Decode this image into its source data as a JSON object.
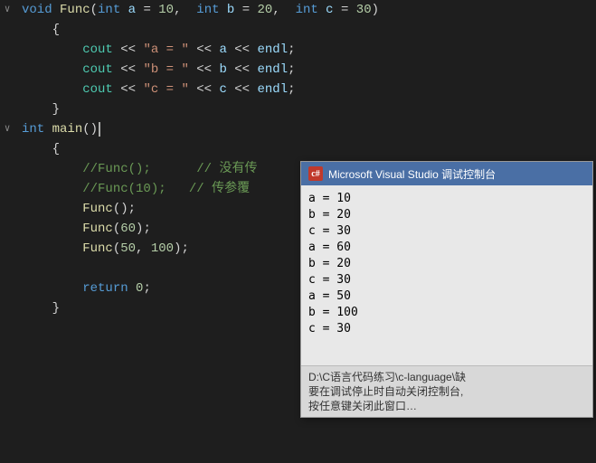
{
  "editor": {
    "background": "#1e1e1e"
  },
  "lines": [
    {
      "num": "",
      "fold": "∨",
      "tokens": [
        {
          "t": "kw",
          "v": "void "
        },
        {
          "t": "fn",
          "v": "Func"
        },
        {
          "t": "plain",
          "v": "("
        },
        {
          "t": "kw",
          "v": "int "
        },
        {
          "t": "param-name",
          "v": "a"
        },
        {
          "t": "plain",
          "v": " = "
        },
        {
          "t": "num",
          "v": "10"
        },
        {
          "t": "plain",
          "v": ",  "
        },
        {
          "t": "kw",
          "v": "int "
        },
        {
          "t": "param-name",
          "v": "b"
        },
        {
          "t": "plain",
          "v": " = "
        },
        {
          "t": "num",
          "v": "20"
        },
        {
          "t": "plain",
          "v": ",  "
        },
        {
          "t": "kw",
          "v": "int "
        },
        {
          "t": "param-name",
          "v": "c"
        },
        {
          "t": "plain",
          "v": " = "
        },
        {
          "t": "num",
          "v": "30"
        },
        {
          "t": "plain",
          "v": ")"
        }
      ]
    },
    {
      "num": "",
      "fold": " ",
      "tokens": [
        {
          "t": "plain",
          "v": "    {"
        }
      ]
    },
    {
      "num": "",
      "fold": " ",
      "tokens": [
        {
          "t": "plain",
          "v": "        "
        },
        {
          "t": "obj",
          "v": "cout"
        },
        {
          "t": "plain",
          "v": " << "
        },
        {
          "t": "str",
          "v": "\"a = \""
        },
        {
          "t": "plain",
          "v": " << "
        },
        {
          "t": "param-name",
          "v": "a"
        },
        {
          "t": "plain",
          "v": " << "
        },
        {
          "t": "param-name",
          "v": "endl"
        },
        {
          "t": "plain",
          "v": ";"
        }
      ]
    },
    {
      "num": "",
      "fold": " ",
      "tokens": [
        {
          "t": "plain",
          "v": "        "
        },
        {
          "t": "obj",
          "v": "cout"
        },
        {
          "t": "plain",
          "v": " << "
        },
        {
          "t": "str",
          "v": "\"b = \""
        },
        {
          "t": "plain",
          "v": " << "
        },
        {
          "t": "param-name",
          "v": "b"
        },
        {
          "t": "plain",
          "v": " << "
        },
        {
          "t": "param-name",
          "v": "endl"
        },
        {
          "t": "plain",
          "v": ";"
        }
      ]
    },
    {
      "num": "",
      "fold": " ",
      "tokens": [
        {
          "t": "plain",
          "v": "        "
        },
        {
          "t": "obj",
          "v": "cout"
        },
        {
          "t": "plain",
          "v": " << "
        },
        {
          "t": "str",
          "v": "\"c = \""
        },
        {
          "t": "plain",
          "v": " << "
        },
        {
          "t": "param-name",
          "v": "c"
        },
        {
          "t": "plain",
          "v": " << "
        },
        {
          "t": "param-name",
          "v": "endl"
        },
        {
          "t": "plain",
          "v": ";"
        }
      ]
    },
    {
      "num": "",
      "fold": " ",
      "tokens": [
        {
          "t": "plain",
          "v": "    }"
        }
      ]
    },
    {
      "num": "",
      "fold": "∨",
      "tokens": [
        {
          "t": "kw",
          "v": "int "
        },
        {
          "t": "fn",
          "v": "main"
        },
        {
          "t": "plain",
          "v": "()"
        },
        {
          "t": "cursor",
          "v": ""
        }
      ]
    },
    {
      "num": "",
      "fold": " ",
      "tokens": [
        {
          "t": "plain",
          "v": "    {"
        }
      ]
    },
    {
      "num": "",
      "fold": " ",
      "tokens": [
        {
          "t": "plain",
          "v": "        "
        },
        {
          "t": "comment",
          "v": "//Func();"
        },
        {
          "t": "plain",
          "v": "      "
        },
        {
          "t": "comment",
          "v": "// 没有传"
        }
      ]
    },
    {
      "num": "",
      "fold": " ",
      "tokens": [
        {
          "t": "plain",
          "v": "        "
        },
        {
          "t": "comment",
          "v": "//Func(10);"
        },
        {
          "t": "plain",
          "v": "   "
        },
        {
          "t": "comment",
          "v": "// 传参覆"
        }
      ]
    },
    {
      "num": "",
      "fold": " ",
      "tokens": [
        {
          "t": "plain",
          "v": "        "
        },
        {
          "t": "fn",
          "v": "Func"
        },
        {
          "t": "plain",
          "v": "();"
        }
      ]
    },
    {
      "num": "",
      "fold": " ",
      "tokens": [
        {
          "t": "plain",
          "v": "        "
        },
        {
          "t": "fn",
          "v": "Func"
        },
        {
          "t": "plain",
          "v": "("
        },
        {
          "t": "num",
          "v": "60"
        },
        {
          "t": "plain",
          "v": ");"
        }
      ]
    },
    {
      "num": "",
      "fold": " ",
      "tokens": [
        {
          "t": "plain",
          "v": "        "
        },
        {
          "t": "fn",
          "v": "Func"
        },
        {
          "t": "plain",
          "v": "("
        },
        {
          "t": "num",
          "v": "50"
        },
        {
          "t": "plain",
          "v": ", "
        },
        {
          "t": "num",
          "v": "100"
        },
        {
          "t": "plain",
          "v": ");"
        }
      ]
    },
    {
      "num": "",
      "fold": " ",
      "tokens": [
        {
          "t": "plain",
          "v": ""
        }
      ]
    },
    {
      "num": "",
      "fold": " ",
      "tokens": [
        {
          "t": "plain",
          "v": "        "
        },
        {
          "t": "kw",
          "v": "return "
        },
        {
          "t": "num",
          "v": "0"
        },
        {
          "t": "plain",
          "v": ";"
        }
      ]
    },
    {
      "num": "",
      "fold": " ",
      "tokens": [
        {
          "t": "plain",
          "v": "    }"
        }
      ]
    }
  ],
  "console": {
    "title": "Microsoft Visual Studio 调试控制台",
    "icon_label": "c#",
    "output": [
      "a = 10",
      "b = 20",
      "c = 30",
      "a = 60",
      "b = 20",
      "c = 30",
      "a = 50",
      "b = 100",
      "c = 30"
    ],
    "footer_line1": "D:\\C语言代码练习\\c-language\\缺",
    "footer_line2": "要在调试停止时自动关闭控制台,",
    "footer_line3": "按任意键关闭此窗口…"
  }
}
